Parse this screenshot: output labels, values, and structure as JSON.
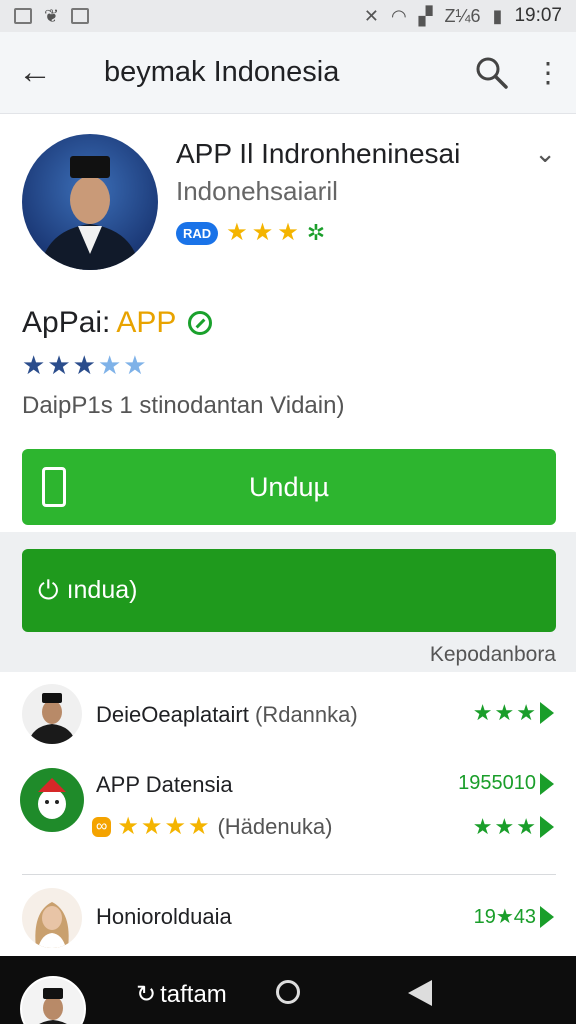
{
  "status_bar": {
    "time": "19:07",
    "network": "Z¼6"
  },
  "app_bar": {
    "title": "beymak Indonesia"
  },
  "header": {
    "app_name": "APP Il Indronheninesai",
    "subtitle": "Indonehsaiaril",
    "badge": "RAD"
  },
  "info": {
    "title_prefix": "ApPai:",
    "title_accent": "APP",
    "description": "DaipP1s 1 stinodantan Vidain)"
  },
  "buttons": {
    "primary_label": "Unduµ",
    "secondary_label": "ındua)"
  },
  "section_caption": "Kepodanbora",
  "list": [
    {
      "title": "DeieOeaplatairt",
      "secondary": "(Rdannka)",
      "right_text": ""
    },
    {
      "title": "APP Datensia",
      "secondary": "(Hädenuka)",
      "right_text": "1955010"
    },
    {
      "title": "Honiorolduaia",
      "secondary": "",
      "right_text": "19★43"
    }
  ],
  "nav_bar": {
    "label": "taftam"
  },
  "colors": {
    "primary_green": "#2db52f",
    "dark_green": "#1f9a1d",
    "star_gold": "#f4b400",
    "badge_blue": "#1a73e8"
  }
}
